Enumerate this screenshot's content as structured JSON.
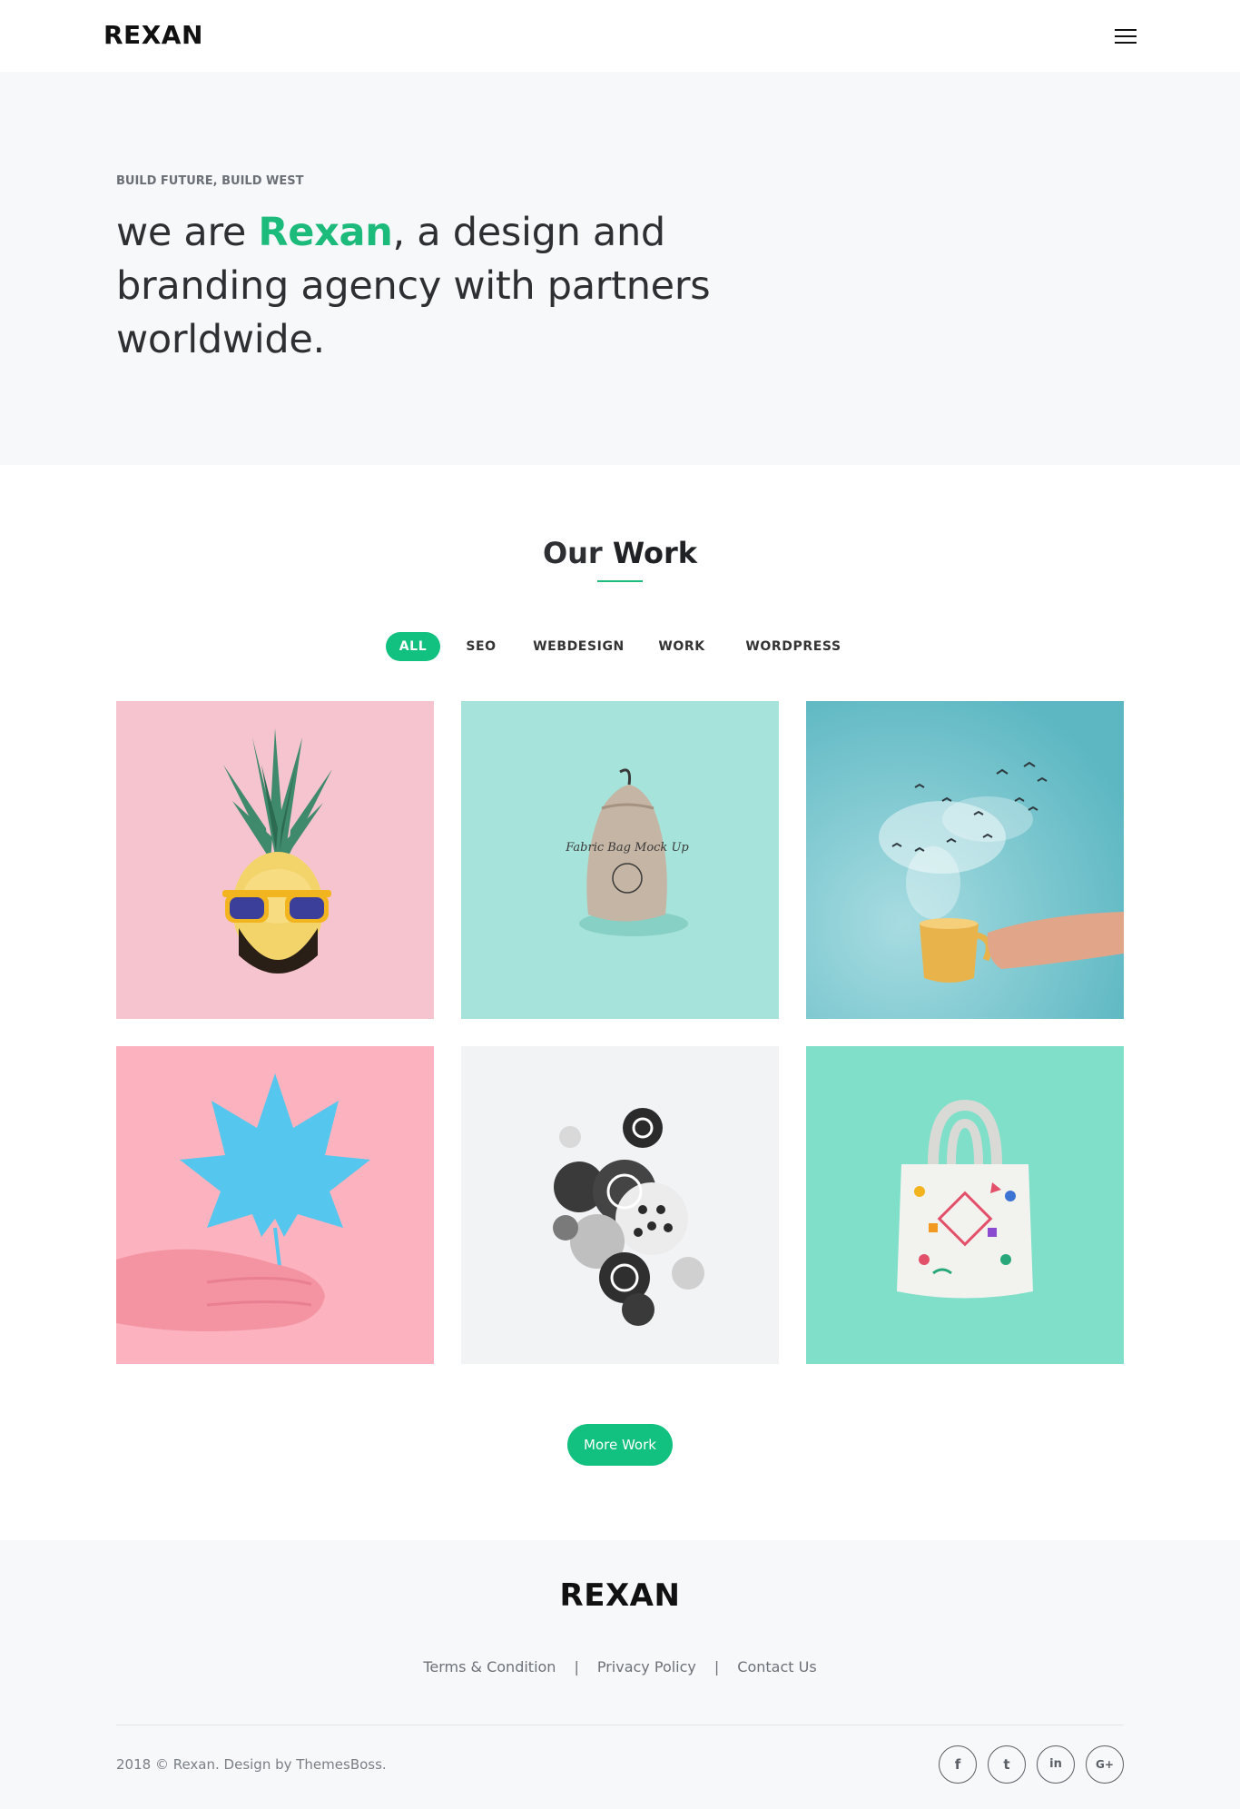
{
  "header": {
    "logo": "REXAN",
    "menu_icon": "hamburger-menu-icon"
  },
  "hero": {
    "tagline": "BUILD FUTURE, BUILD WEST",
    "title_prefix": "we are ",
    "title_brand": "Rexan",
    "title_suffix": ", a design and branding agency with partners worldwide.",
    "brand_color": "#1dbb7b"
  },
  "work": {
    "title_light": "Our ",
    "title_bold": "Work",
    "filters": [
      "ALL",
      "SEO",
      "WEBDESIGN",
      "WORK",
      "WORDPRESS"
    ],
    "active_filter": "ALL",
    "items": [
      {
        "subject": "pineapple-with-sunglasses",
        "bg": "#f6c4cf"
      },
      {
        "subject": "fabric-bag-mockup",
        "bg": "#a6e3da"
      },
      {
        "subject": "coffee-cup-steam-birds",
        "bg": "#69bfc9"
      },
      {
        "subject": "hand-holding-blue-leaf",
        "bg": "#fcb3bf"
      },
      {
        "subject": "patterned-spheres",
        "bg": "#f2f3f5"
      },
      {
        "subject": "tote-bag-mockup",
        "bg": "#7fdfc9"
      }
    ],
    "bag_text": "Fabric Bag Mock Up",
    "more_button": "More Work",
    "accent_color": "#12c07f"
  },
  "footer": {
    "logo": "REXAN",
    "links": [
      "Terms & Condition",
      "Privacy Policy",
      "Contact Us"
    ],
    "separator": "|",
    "copyright": "2018 © Rexan. Design by ThemesBoss.",
    "socials": [
      {
        "icon": "facebook-icon",
        "glyph": "f"
      },
      {
        "icon": "twitter-icon",
        "glyph": "t"
      },
      {
        "icon": "linkedin-icon",
        "glyph": "in"
      },
      {
        "icon": "google-plus-icon",
        "glyph": "G+"
      }
    ]
  }
}
